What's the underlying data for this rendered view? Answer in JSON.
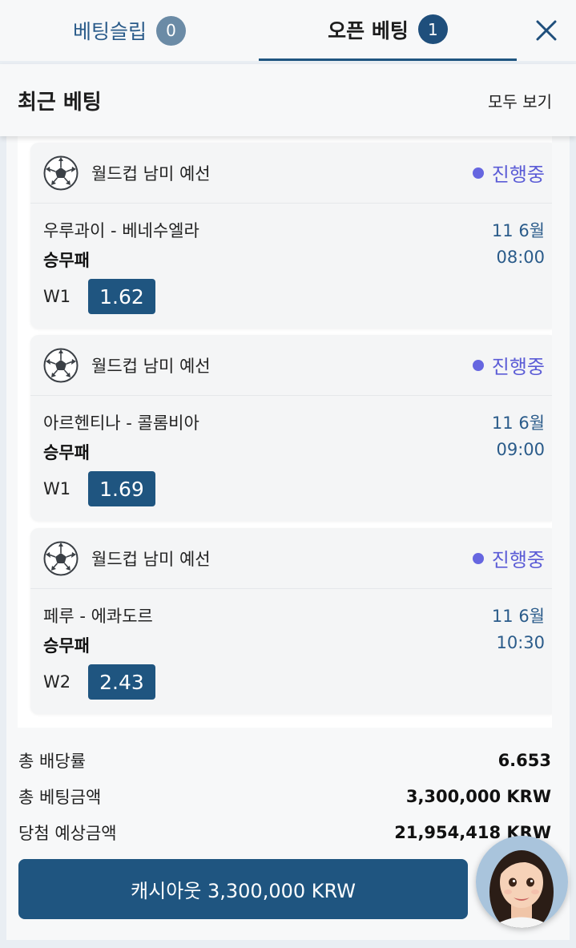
{
  "tabs": {
    "slip_label": "베팅슬립",
    "slip_count": "0",
    "open_label": "오픈 베팅",
    "open_count": "1"
  },
  "header": {
    "title": "최근 베팅",
    "see_all": "모두 보기"
  },
  "bets": [
    {
      "league": "월드컵 남미 예선",
      "status": "진행중",
      "match": "우루과이 - 베네수엘라",
      "date": "11 6월",
      "market": "승무패",
      "time": "08:00",
      "pick": "W1",
      "odds": "1.62"
    },
    {
      "league": "월드컵 남미 예선",
      "status": "진행중",
      "match": "아르헨티나 - 콜롬비아",
      "date": "11 6월",
      "market": "승무패",
      "time": "09:00",
      "pick": "W1",
      "odds": "1.69"
    },
    {
      "league": "월드컵 남미 예선",
      "status": "진행중",
      "match": "페루 - 에콰도르",
      "date": "11 6월",
      "market": "승무패",
      "time": "10:30",
      "pick": "W2",
      "odds": "2.43"
    }
  ],
  "totals": {
    "odds_label": "총 배당률",
    "odds_value": "6.653",
    "stake_label": "총 베팅금액",
    "stake_value": "3,300,000 KRW",
    "payout_label": "당첨 예상금액",
    "payout_value": "21,954,418 KRW"
  },
  "cashout": {
    "label": "캐시아웃 3,300,000 KRW"
  },
  "colors": {
    "primary": "#1f5580",
    "status": "#5b5cd6",
    "link_text": "#2a5b8a"
  },
  "icons": [
    "soccer-ball-icon",
    "close-icon",
    "assistant-avatar"
  ]
}
